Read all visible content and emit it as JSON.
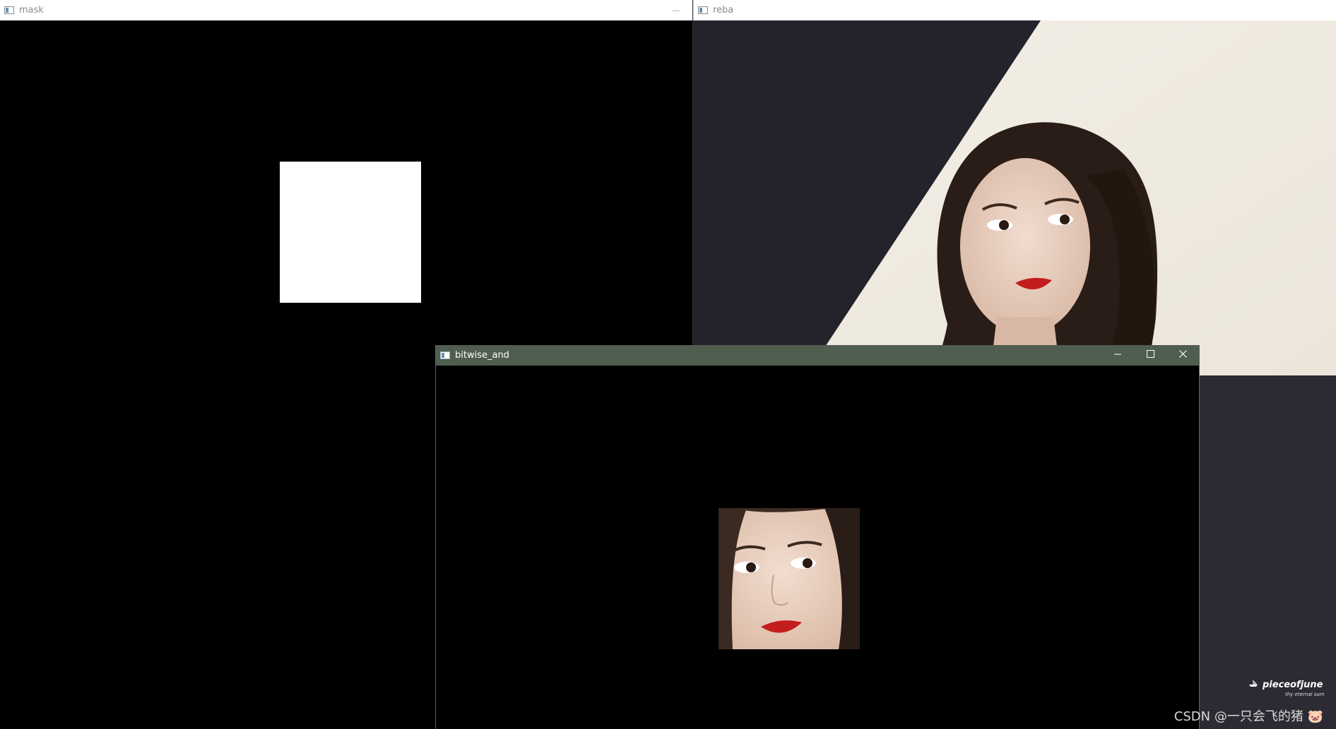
{
  "windows": {
    "mask": {
      "title": "mask",
      "minimize_glyph": "—"
    },
    "reba": {
      "title": "reba",
      "overlay_brand": "pieceofjune",
      "overlay_tagline": "thy eternal sum"
    },
    "bitwise_and": {
      "title": "bitwise_and",
      "minimize_glyph": "—",
      "maximize_glyph": "☐",
      "close_glyph": "✕"
    }
  },
  "watermark": "CSDN @一只会飞的猪 🐷",
  "icons": {
    "app": "app-window-icon",
    "minimize": "minimize-icon",
    "maximize": "maximize-icon",
    "close": "close-icon",
    "brand": "boat-icon"
  },
  "colors": {
    "active_titlebar": "#4f5e4f",
    "inactive_titlebar": "#ffffff",
    "mask_white": "#ffffff",
    "background": "#000000"
  }
}
